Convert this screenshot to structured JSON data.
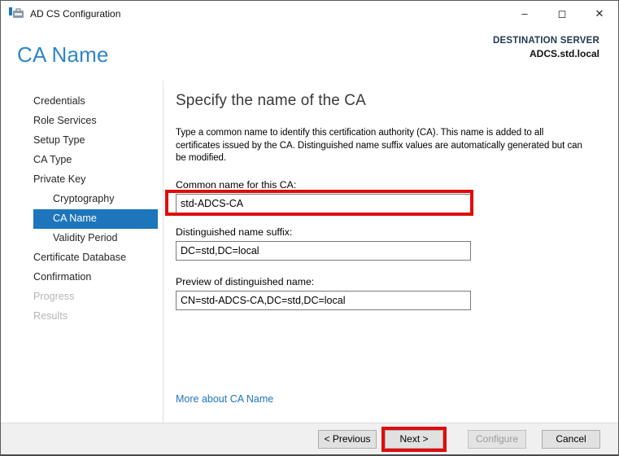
{
  "window": {
    "title": "AD CS Configuration",
    "icon": "adcs-toolbox-icon",
    "controls": {
      "minimize": "–",
      "maximize": "◻",
      "close": "✕"
    }
  },
  "header": {
    "page_title": "CA Name",
    "destination_label": "DESTINATION SERVER",
    "destination_server": "ADCS.std.local"
  },
  "sidebar": {
    "items": [
      {
        "label": "Credentials",
        "level": 1,
        "state": "normal"
      },
      {
        "label": "Role Services",
        "level": 1,
        "state": "normal"
      },
      {
        "label": "Setup Type",
        "level": 1,
        "state": "normal"
      },
      {
        "label": "CA Type",
        "level": 1,
        "state": "normal"
      },
      {
        "label": "Private Key",
        "level": 1,
        "state": "normal"
      },
      {
        "label": "Cryptography",
        "level": 2,
        "state": "normal"
      },
      {
        "label": "CA Name",
        "level": 2,
        "state": "selected"
      },
      {
        "label": "Validity Period",
        "level": 2,
        "state": "normal"
      },
      {
        "label": "Certificate Database",
        "level": 1,
        "state": "normal"
      },
      {
        "label": "Confirmation",
        "level": 1,
        "state": "normal"
      },
      {
        "label": "Progress",
        "level": 1,
        "state": "disabled"
      },
      {
        "label": "Results",
        "level": 1,
        "state": "disabled"
      }
    ]
  },
  "main": {
    "heading": "Specify the name of the CA",
    "description": "Type a common name to identify this certification authority (CA). This name is added to all\ncertificates issued by the CA. Distinguished name suffix values are automatically generated but can\nbe modified.",
    "fields": [
      {
        "label": "Common name for this CA:",
        "value": "std-ADCS-CA",
        "annotated": true
      },
      {
        "label": "Distinguished name suffix:",
        "value": "DC=std,DC=local",
        "annotated": false
      },
      {
        "label": "Preview of distinguished name:",
        "value": "CN=std-ADCS-CA,DC=std,DC=local",
        "annotated": false
      }
    ],
    "link": "More about CA Name"
  },
  "footer": {
    "buttons": [
      {
        "label": "< Previous",
        "disabled": false,
        "annotated": false
      },
      {
        "label": "Next >",
        "disabled": false,
        "annotated": true
      },
      {
        "label": "Configure",
        "disabled": true,
        "annotated": false
      },
      {
        "label": "Cancel",
        "disabled": false,
        "annotated": false
      }
    ]
  },
  "colors": {
    "accent_blue": "#1d76bb",
    "title_blue": "#2e87c8",
    "link_blue": "#1e73be",
    "annotation_red": "#e00b0b",
    "footer_gray": "#f0f0f0"
  }
}
